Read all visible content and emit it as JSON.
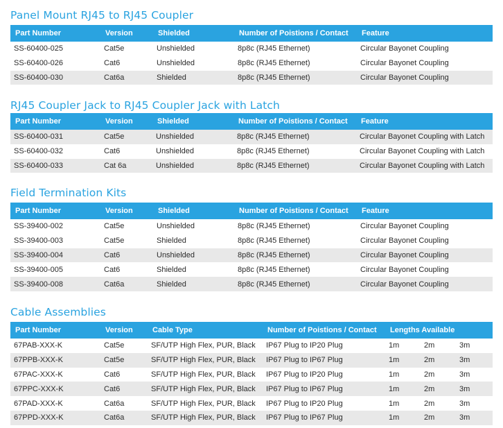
{
  "sections": [
    {
      "title": "Panel Mount RJ45 to RJ45 Coupler",
      "headers": [
        "Part Number",
        "Version",
        "Shielded",
        "Number of Poistions / Contact",
        "Feature"
      ],
      "rows": [
        [
          "SS-60400-025",
          "Cat5e",
          "Unshielded",
          "8p8c (RJ45 Ethernet)",
          "Circular Bayonet Coupling"
        ],
        [
          "SS-60400-026",
          "Cat6",
          "Unshielded",
          "8p8c (RJ45 Ethernet)",
          "Circular Bayonet Coupling"
        ],
        [
          "SS-60400-030",
          "Cat6a",
          "Shielded",
          "8p8c (RJ45 Ethernet)",
          "Circular Bayonet Coupling"
        ]
      ]
    },
    {
      "title": "RJ45 Coupler Jack to RJ45 Coupler Jack with Latch",
      "headers": [
        "Part Number",
        "Version",
        "Shielded",
        "Number of Poistions / Contact",
        "Feature"
      ],
      "rows": [
        [
          "SS-60400-031",
          "Cat5e",
          "Unshielded",
          "8p8c (RJ45 Ethernet)",
          "Circular Bayonet Coupling with Latch"
        ],
        [
          "SS-60400-032",
          "Cat6",
          "Unshielded",
          "8p8c (RJ45 Ethernet)",
          "Circular Bayonet Coupling with Latch"
        ],
        [
          "SS-60400-033",
          "Cat 6a",
          "Unshielded",
          "8p8c (RJ45 Ethernet)",
          "Circular Bayonet Coupling with Latch"
        ]
      ]
    },
    {
      "title": "Field Termination Kits",
      "headers": [
        "Part Number",
        "Version",
        "Shielded",
        "Number of Poistions / Contact",
        "Feature"
      ],
      "rows": [
        [
          "SS-39400-002",
          "Cat5e",
          "Unshielded",
          "8p8c (RJ45 Ethernet)",
          "Circular Bayonet Coupling"
        ],
        [
          "SS-39400-003",
          "Cat5e",
          "Shielded",
          "8p8c (RJ45 Ethernet)",
          "Circular Bayonet Coupling"
        ],
        [
          "SS-39400-004",
          "Cat6",
          "Unshielded",
          "8p8c (RJ45 Ethernet)",
          "Circular Bayonet Coupling"
        ],
        [
          "SS-39400-005",
          "Cat6",
          "Shielded",
          "8p8c (RJ45 Ethernet)",
          "Circular Bayonet Coupling"
        ],
        [
          "SS-39400-008",
          "Cat6a",
          "Shielded",
          "8p8c (RJ45 Ethernet)",
          "Circular Bayonet Coupling"
        ]
      ]
    },
    {
      "title": "Cable Assemblies",
      "headers": [
        "Part Number",
        "Version",
        "Cable Type",
        "Number of Poistions / Contact",
        "Lengths Available"
      ],
      "rows": [
        [
          "67PAB-XXX-K",
          "Cat5e",
          "SF/UTP High Flex, PUR, Black",
          "IP67 Plug to IP20 Plug",
          "1m",
          "2m",
          "3m"
        ],
        [
          "67PPB-XXX-K",
          "Cat5e",
          "SF/UTP High Flex, PUR, Black",
          "IP67 Plug to IP67 Plug",
          "1m",
          "2m",
          "3m"
        ],
        [
          "67PAC-XXX-K",
          "Cat6",
          "SF/UTP High Flex, PUR, Black",
          "IP67 Plug to IP20 Plug",
          "1m",
          "2m",
          "3m"
        ],
        [
          "67PPC-XXX-K",
          "Cat6",
          "SF/UTP High Flex, PUR, Black",
          "IP67 Plug to IP67 Plug",
          "1m",
          "2m",
          "3m"
        ],
        [
          "67PAD-XXX-K",
          "Cat6a",
          "SF/UTP High Flex, PUR, Black",
          "IP67 Plug to IP20 Plug",
          "1m",
          "2m",
          "3m"
        ],
        [
          "67PPD-XXX-K",
          "Cat6a",
          "SF/UTP High Flex, PUR, Black",
          "IP67 Plug to IP67 Plug",
          "1m",
          "2m",
          "3m"
        ]
      ]
    }
  ],
  "colors": {
    "accent": "#2aa3e0",
    "row_alt": "#e8e8e8",
    "text": "#2b2b2b"
  }
}
